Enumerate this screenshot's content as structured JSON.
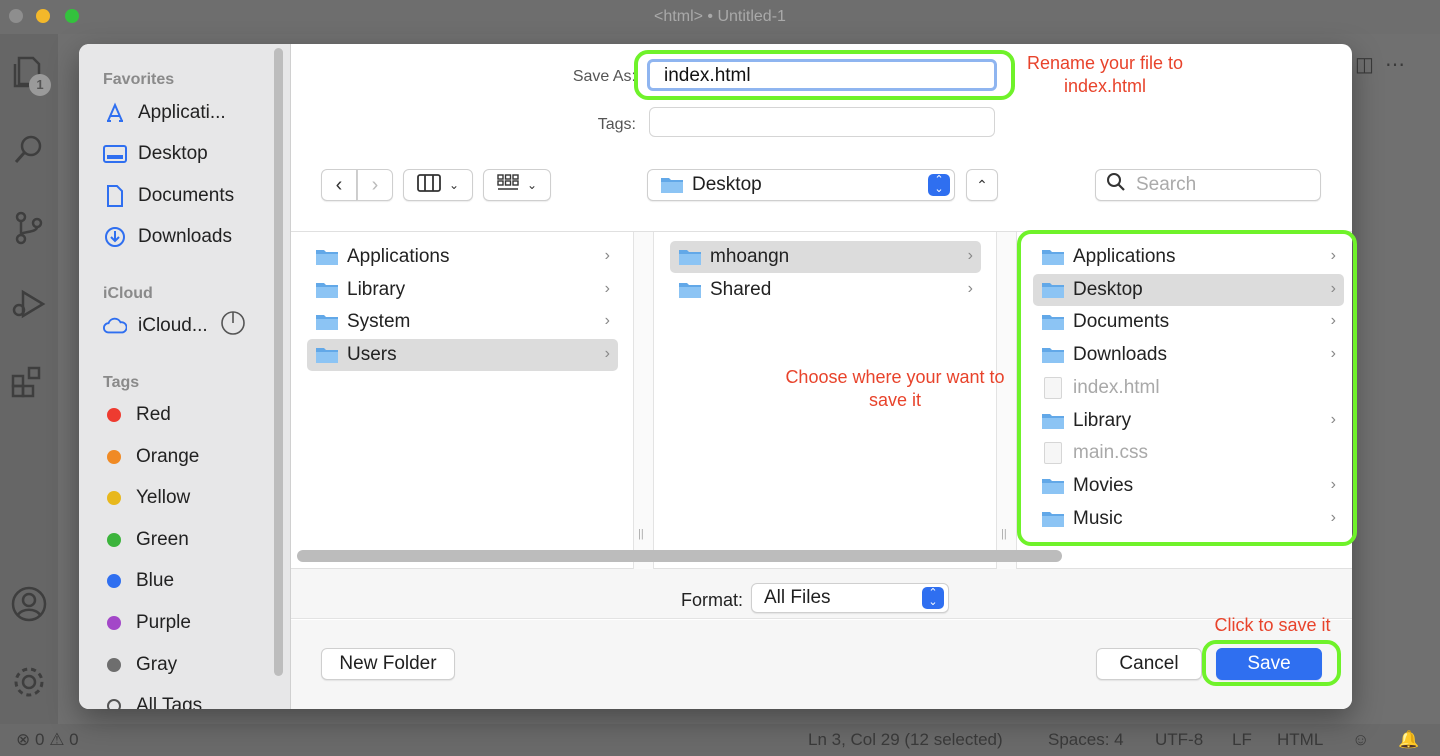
{
  "window": {
    "title": "<html> • Untitled-1"
  },
  "activity_bar": {
    "badge": "1"
  },
  "status_bar": {
    "errors": "0",
    "warnings": "0",
    "position": "Ln 3, Col 29 (12 selected)",
    "spaces": "Spaces: 4",
    "encoding": "UTF-8",
    "eol": "LF",
    "language": "HTML"
  },
  "sidebar": {
    "favorites_title": "Favorites",
    "favorites": [
      {
        "label": "Applicati...",
        "icon": "applications-icon"
      },
      {
        "label": "Desktop",
        "icon": "desktop-icon"
      },
      {
        "label": "Documents",
        "icon": "document-icon"
      },
      {
        "label": "Downloads",
        "icon": "download-icon"
      }
    ],
    "icloud_title": "iCloud",
    "icloud": [
      {
        "label": "iCloud...",
        "icon": "cloud-icon"
      }
    ],
    "tags_title": "Tags",
    "tags": [
      {
        "label": "Red",
        "color": "#ee3b30"
      },
      {
        "label": "Orange",
        "color": "#f08a24"
      },
      {
        "label": "Yellow",
        "color": "#e8b81c"
      },
      {
        "label": "Green",
        "color": "#3cb43c"
      },
      {
        "label": "Blue",
        "color": "#2f6ff0"
      },
      {
        "label": "Purple",
        "color": "#a347c8"
      },
      {
        "label": "Gray",
        "color": "#6e6e6e"
      },
      {
        "label": "All Tags",
        "color": ""
      }
    ]
  },
  "form": {
    "save_as_label": "Save As:",
    "save_as_value": "index.html",
    "tags_label": "Tags:",
    "location": "Desktop",
    "search_placeholder": "Search",
    "format_label": "Format:",
    "format_value": "All Files"
  },
  "columns": [
    {
      "items": [
        {
          "label": "Applications",
          "selected": false
        },
        {
          "label": "Library",
          "selected": false
        },
        {
          "label": "System",
          "selected": false
        },
        {
          "label": "Users",
          "selected": true
        }
      ]
    },
    {
      "items": [
        {
          "label": "mhoangn",
          "selected": true
        },
        {
          "label": "Shared",
          "selected": false
        }
      ]
    },
    {
      "items": [
        {
          "label": "Applications",
          "type": "folder",
          "selected": false
        },
        {
          "label": "Desktop",
          "type": "folder",
          "selected": true
        },
        {
          "label": "Documents",
          "type": "folder",
          "selected": false
        },
        {
          "label": "Downloads",
          "type": "folder",
          "selected": false
        },
        {
          "label": "index.html",
          "type": "file",
          "selected": false
        },
        {
          "label": "Library",
          "type": "folder",
          "selected": false
        },
        {
          "label": "main.css",
          "type": "file",
          "selected": false
        },
        {
          "label": "Movies",
          "type": "folder",
          "selected": false
        },
        {
          "label": "Music",
          "type": "folder",
          "selected": false
        }
      ]
    }
  ],
  "buttons": {
    "new_folder": "New Folder",
    "cancel": "Cancel",
    "save": "Save"
  },
  "annotations": {
    "rename": "Rename your file to\nindex.html",
    "choose": "Choose where your want to\nsave it",
    "click": "Click to save it",
    "color": "#e8432b",
    "ring_color": "#6ff22a"
  }
}
